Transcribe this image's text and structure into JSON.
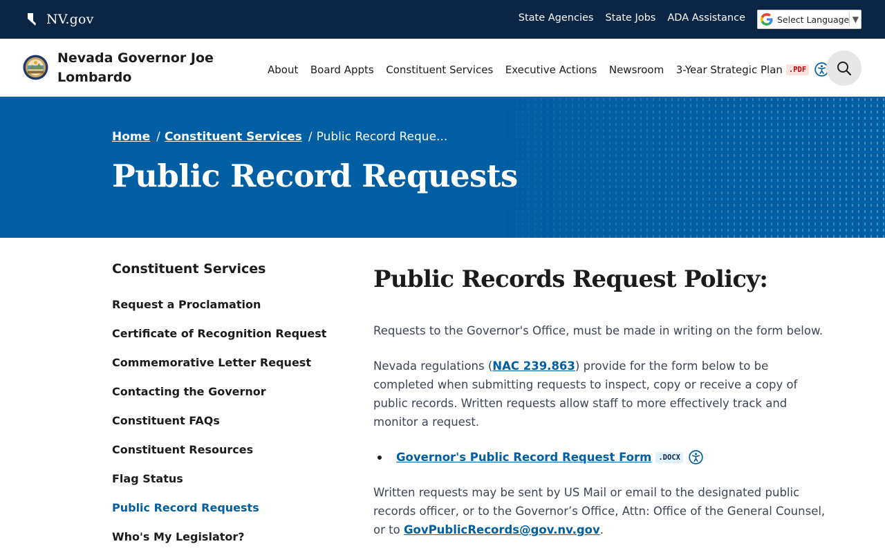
{
  "topbar": {
    "brand": "NV.gov",
    "links": [
      "State Agencies",
      "State Jobs",
      "ADA Assistance"
    ],
    "language": {
      "label": "Select Language",
      "caret": "▼"
    }
  },
  "header": {
    "site_title": "Nevada Governor Joe Lombardo",
    "nav": [
      "About",
      "Board Appts",
      "Constituent Services",
      "Executive Actions",
      "Newsroom",
      "3-Year Strategic Plan"
    ],
    "pdf_badge": ".PDF"
  },
  "hero": {
    "breadcrumb": {
      "home": "Home",
      "parent": "Constituent Services",
      "current": "Public Record Reque...",
      "separator": "/"
    },
    "title": "Public Record Requests"
  },
  "sidebar": {
    "heading": "Constituent Services",
    "items": [
      "Request a Proclamation",
      "Certificate of Recognition Request",
      "Commemorative Letter Request",
      "Contacting the Governor",
      "Constituent FAQs",
      "Constituent Resources",
      "Flag Status",
      "Public Record Requests",
      "Who's My Legislator?"
    ],
    "active_index": 7
  },
  "content": {
    "heading": "Public Records Request Policy:",
    "p1": "Requests to the Governor's Office, must be made in writing on the form below.",
    "p2_before": "Nevada regulations (",
    "p2_link": "NAC 239.863",
    "p2_after": ") provide for the form below to be completed when submitting requests to inspect, copy or receive a copy of public records. Written requests allow staff to more effectively track and monitor a request.",
    "form_link": "Governor's Public Record Request Form",
    "docx_badge": ".DOCX",
    "p3_before": "Written requests may be sent by US Mail or email to the designated public records officer, or to the Governor’s Office, Attn: Office of the General Counsel, or to ",
    "p3_link": "GovPublicRecords@gov.nv.gov",
    "p3_after": "."
  },
  "colors": {
    "topbar_bg": "#0b2545",
    "hero_bg": "#005ea2",
    "link": "#005ea2",
    "pdf_badge_bg": "#fbe0e0",
    "docx_badge_bg": "#e1f1fb"
  },
  "icons": [
    "nevada-state-icon",
    "google-icon",
    "state-seal-icon",
    "accessibility-icon",
    "search-icon"
  ]
}
